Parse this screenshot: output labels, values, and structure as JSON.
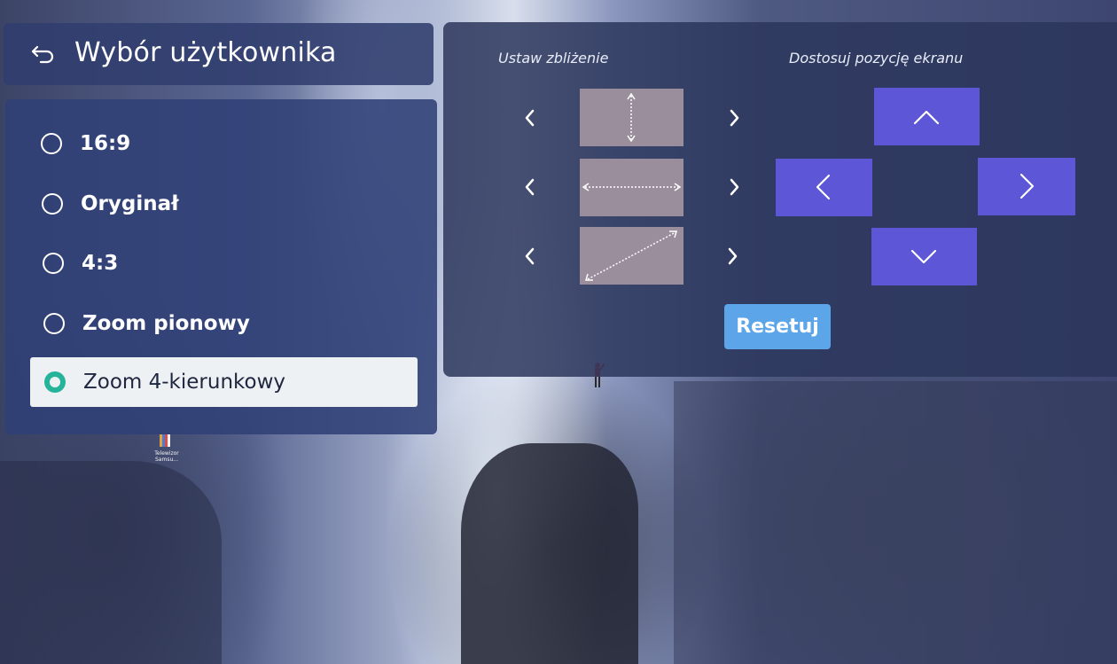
{
  "header": {
    "back_icon": "back-arrow-icon",
    "title": "Wybór użytkownika"
  },
  "options": [
    {
      "label": "16:9",
      "selected": false
    },
    {
      "label": "Oryginał",
      "selected": false
    },
    {
      "label": "4:3",
      "selected": false
    },
    {
      "label": "Zoom pionowy",
      "selected": false
    },
    {
      "label": "Zoom 4-kierunkowy",
      "selected": true
    }
  ],
  "zoom_section": {
    "label": "Ustaw zbliżenie",
    "rows": [
      {
        "name": "vertical",
        "icon": "vertical-stretch-icon"
      },
      {
        "name": "horizontal",
        "icon": "horizontal-stretch-icon"
      },
      {
        "name": "diagonal",
        "icon": "diagonal-stretch-icon"
      }
    ]
  },
  "position_section": {
    "label": "Dostosuj pozycję ekranu",
    "buttons": [
      "up",
      "left",
      "right",
      "down"
    ]
  },
  "reset_label": "Resetuj",
  "desktop_shortcut": {
    "label": "Telewizor Samsu..."
  },
  "colors": {
    "panel_bg": "#30407a",
    "zoom_box": "#9a8d9c",
    "position_button": "#5d56d6",
    "reset_button": "#5ba5e8",
    "selected_radio": "#25b39a",
    "selected_row_bg": "#eef1f4"
  }
}
